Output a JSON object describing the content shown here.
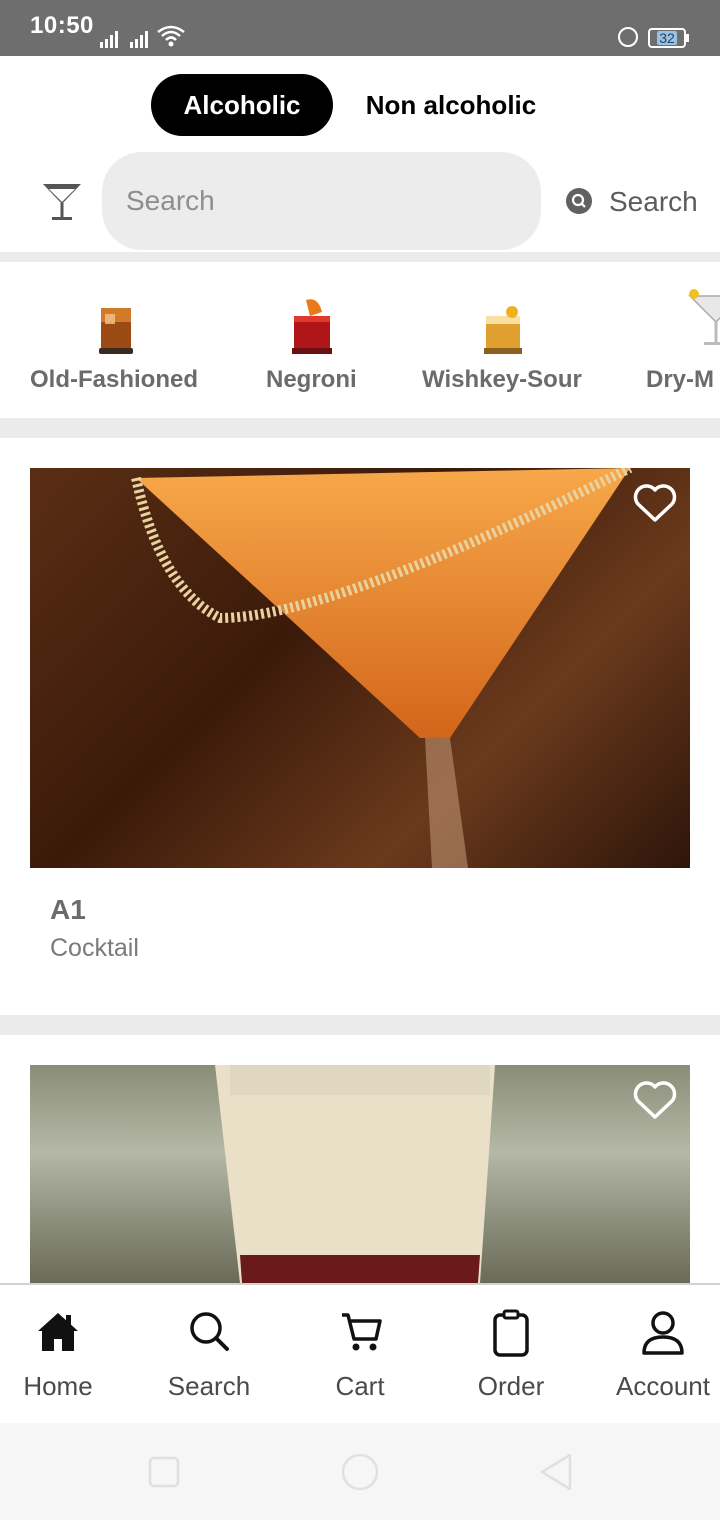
{
  "status_bar": {
    "time": "10:50",
    "battery": "32"
  },
  "drink_toggle": {
    "options": [
      "Alcoholic",
      "Non alcoholic"
    ],
    "selected": "Alcoholic"
  },
  "search": {
    "placeholder": "Search",
    "button_label": "Search"
  },
  "categories": [
    {
      "label": "Old-Fashioned",
      "icon": "old-fashioned-glass-icon"
    },
    {
      "label": "Negroni",
      "icon": "negroni-glass-icon"
    },
    {
      "label": "Wishkey-Sour",
      "icon": "whiskey-sour-glass-icon"
    },
    {
      "label": "Dry-M",
      "icon": "martini-glass-icon"
    }
  ],
  "drinks": [
    {
      "name": "A1",
      "category": "Cocktail",
      "favorite": false
    },
    {
      "name": "",
      "category": "",
      "favorite": false
    }
  ],
  "bottom_nav": {
    "items": [
      {
        "label": "Home",
        "icon": "home-icon"
      },
      {
        "label": "Search",
        "icon": "search-icon"
      },
      {
        "label": "Cart",
        "icon": "cart-icon"
      },
      {
        "label": "Order",
        "icon": "order-icon"
      },
      {
        "label": "Account",
        "icon": "account-icon"
      }
    ],
    "active": "Home"
  },
  "colors": {
    "accent": "#000000",
    "status_bar": "#6e6e6e",
    "label_gray": "#6b6b6b",
    "search_bg": "#ececec"
  }
}
